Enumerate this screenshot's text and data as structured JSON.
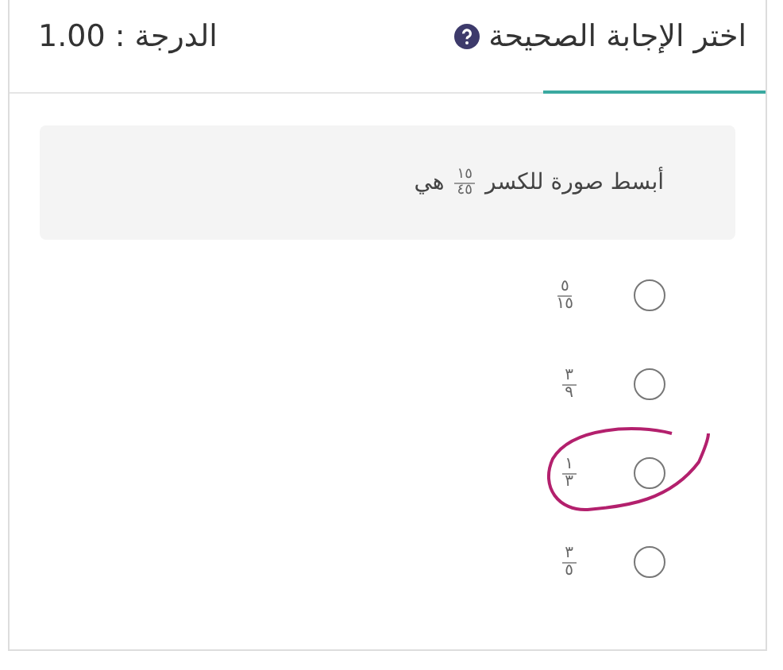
{
  "header": {
    "title": "اختر الإجابة الصحيحة",
    "score": "الدرجة : 1.00"
  },
  "question": {
    "before": "أبسط صورة للكسر",
    "fraction": {
      "numerator": "١٥",
      "denominator": "٤٥"
    },
    "after": "هي"
  },
  "options": [
    {
      "numerator": "٥",
      "denominator": "١٥",
      "selected": false
    },
    {
      "numerator": "٣",
      "denominator": "٩",
      "selected": false
    },
    {
      "numerator": "١",
      "denominator": "٣",
      "selected": false
    },
    {
      "numerator": "٣",
      "denominator": "٥",
      "selected": false
    }
  ]
}
